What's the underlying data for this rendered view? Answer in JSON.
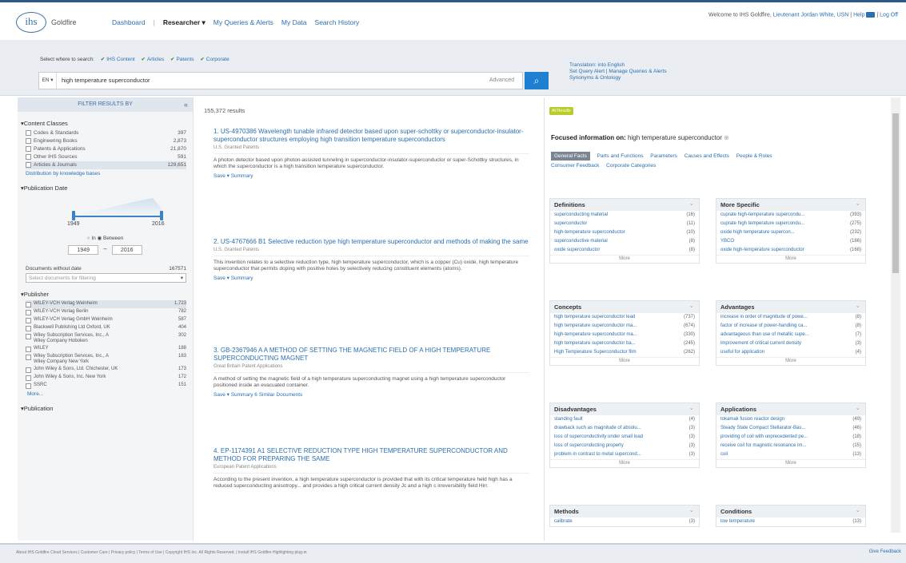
{
  "header": {
    "logo": "ihs",
    "brand": "Goldfire",
    "nav": [
      "Dashboard",
      "Researcher ▾",
      "My Queries & Alerts",
      "My Data",
      "Search History"
    ],
    "welcome_prefix": "Welcome to IHS Goldfire,",
    "welcome_user": "Lieutenant Jordan White, USN",
    "help": "Help",
    "logoff": "Log Off"
  },
  "search": {
    "where_label": "Select where to search:",
    "sources": [
      "IHS Content",
      "Articles",
      "Patents",
      "Corporate"
    ],
    "prefix": "EN ▾",
    "query": "high temperature superconductor",
    "advanced": "Advanced",
    "right_links": [
      "Translation: into English",
      "Set Query Alert | Manage Queries & Alerts",
      "Synonyms & Ontology"
    ]
  },
  "filter": {
    "head": "FILTER RESULTS BY",
    "content_classes_title": "▾Content Classes",
    "content_classes": [
      {
        "label": "Codes & Standards",
        "count": "397"
      },
      {
        "label": "Engineering Books",
        "count": "2,873"
      },
      {
        "label": "Patents & Applications",
        "count": "21,870"
      },
      {
        "label": "Other IHS Sources",
        "count": "591"
      },
      {
        "label": "Articles & Journals",
        "count": "129,651"
      }
    ],
    "distribution": "Distribution by knowledge bases",
    "pub_date_title": "▾Publication Date",
    "year_min": "1949",
    "year_max": "2016",
    "radio": "○ In  ◉ Between",
    "without_date_label": "Documents without date",
    "without_date_count": "167571",
    "select_placeholder": "Select documents for filtering",
    "publisher_title": "▾Publisher",
    "publishers": [
      {
        "label": "WILEY-VCH Verlag Weinheim",
        "count": "1,723"
      },
      {
        "label": "WILEY-VCH Verlag Berlin",
        "count": "782"
      },
      {
        "label": "WILEY-VCH Verlag GmbH Weinheim",
        "count": "587"
      },
      {
        "label": "Blackwell Publishing Ltd Oxford, UK",
        "count": "404"
      },
      {
        "label": "Wiley Subscription Services, Inc., A Wiley Company Hoboken",
        "count": "302"
      },
      {
        "label": "WILEY",
        "count": "188"
      },
      {
        "label": "Wiley Subscription Services, Inc., A Wiley Company New York",
        "count": "183"
      },
      {
        "label": "John Wiley & Sons, Ltd. Chichester, UK",
        "count": "173"
      },
      {
        "label": "John Wiley & Sons, Inc. New York",
        "count": "172"
      },
      {
        "label": "SSRC",
        "count": "151"
      }
    ],
    "more": "More...",
    "publication_title": "▾Publication"
  },
  "results": {
    "count": "155,372 results",
    "items": [
      {
        "title": "1. US-4970386 Wavelength tunable infrared detector based upon super-schottky or superconductor-insulator-superconductor structures employing high transition temperature superconductors",
        "source": "U.S. Granted Patents",
        "snippet": "A photon detector based upon photon-assisted tunneling in superconductor-insulator-superconductor or super-Schottky structures, in which the superconductor is a high transition temperature superconductor.",
        "actions": "Save ▾   Summary"
      },
      {
        "title": "2. US-4767666 B1 Selective reduction type high temperature superconductor and methods of making the same",
        "source": "U.S. Granted Patents",
        "snippet": "This invention relates to a selective reduction type, high temperature superconductor, which is a copper (Cu) oxide, high temperature superconductor that permits doping with positive holes by selectively reducing constituent elements (atoms).",
        "actions": "Save ▾   Summary"
      },
      {
        "title": "3. GB-2367946 A A METHOD OF SETTING THE MAGNETIC FIELD OF A HIGH TEMPERATURE SUPERCONDUCTING MAGNET",
        "source": "Great Britain Patent Applications",
        "snippet": "A method of setting the magnetic field of a high temperature superconducting magnet using a high temperature superconductor positioned inside an evacuated container.",
        "actions": "Save ▾   Summary   6 Similar Documents"
      },
      {
        "title": "4. EP-1174391 A1 SELECTIVE REDUCTION TYPE HIGH TEMPERATURE SUPERCONDUCTOR AND METHOD FOR PREPARING THE SAME",
        "source": "European Patent Applications",
        "snippet": "According to the present invention, a high temperature superconductor is provided that with its critical temperature held high has a reduced superconducting anisotropy... and provides a high critical current density Jc and a high c irreversibility field Hirr.",
        "actions": ""
      }
    ]
  },
  "focus": {
    "badge": "All Results",
    "label": "Focused information on:",
    "query": "high temperature superconductor",
    "tabs": [
      "General Facts",
      "Parts and Functions",
      "Parameters",
      "Causes and Effects",
      "People & Roles",
      "Consumer Feedback",
      "Corporate Categories"
    ],
    "more": "More",
    "boxes": {
      "definitions": {
        "title": "Definitions",
        "rows": [
          [
            "superconducting material",
            "(16)"
          ],
          [
            "superconductor",
            "(11)"
          ],
          [
            "high-temperature superconductor",
            "(10)"
          ],
          [
            "superconductive material",
            "(8)"
          ],
          [
            "oxide superconductor",
            "(8)"
          ]
        ]
      },
      "more_specific": {
        "title": "More Specific",
        "rows": [
          [
            "cuprate high-temperature supercondu...",
            "(393)"
          ],
          [
            "cuprate high temperature supercondu...",
            "(275)"
          ],
          [
            "oxide high temperature supercon...",
            "(232)"
          ],
          [
            "YBCO",
            "(186)"
          ],
          [
            "oxide high-temperature superconductor",
            "(168)"
          ]
        ]
      },
      "concepts": {
        "title": "Concepts",
        "rows": [
          [
            "high temperature superconductor lead",
            "(737)"
          ],
          [
            "high temperature superconductor ma...",
            "(674)"
          ],
          [
            "high-temperature superconductor ma...",
            "(330)"
          ],
          [
            "high temperature superconductor ba...",
            "(245)"
          ],
          [
            "High Temperature Superconductor film",
            "(262)"
          ]
        ]
      },
      "advantages": {
        "title": "Advantages",
        "rows": [
          [
            "increase in order of magnitude of powe...",
            "(8)"
          ],
          [
            "factor of increase of power-handling ca...",
            "(8)"
          ],
          [
            "advantageous than use of metallic supe...",
            "(7)"
          ],
          [
            "improvement of critical current density",
            "(3)"
          ],
          [
            "useful for application",
            "(4)"
          ]
        ]
      },
      "disadvantages": {
        "title": "Disadvantages",
        "rows": [
          [
            "standing fault",
            "(4)"
          ],
          [
            "drawback such as magnitude of absolu...",
            "(3)"
          ],
          [
            "loss of superconductivity under small load",
            "(3)"
          ],
          [
            "loss of superconducting property",
            "(3)"
          ],
          [
            "problem in contrast to metal supercond...",
            "(3)"
          ]
        ]
      },
      "applications": {
        "title": "Applications",
        "rows": [
          [
            "tokamak fusion reactor design",
            "(49)"
          ],
          [
            "Steady State Compact Stellarator-Bas...",
            "(46)"
          ],
          [
            "providing of coil with unprecedented pe...",
            "(18)"
          ],
          [
            "receive coil for magnetic resonance im...",
            "(15)"
          ],
          [
            "coil",
            "(13)"
          ]
        ]
      },
      "methods": {
        "title": "Methods",
        "rows": [
          [
            "calibrate",
            "(3)"
          ]
        ]
      },
      "conditions": {
        "title": "Conditions",
        "rows": [
          [
            "low temperature",
            "(13)"
          ]
        ]
      }
    }
  },
  "footer": {
    "text": "About IHS Goldfire Cloud Services | Customer Care | Privacy policy | Terms of Use | Copyright IHS Inc. All Rights Reserved. | Install IHS Goldfire Highlighting plug-in",
    "right": "Give Feedback"
  }
}
